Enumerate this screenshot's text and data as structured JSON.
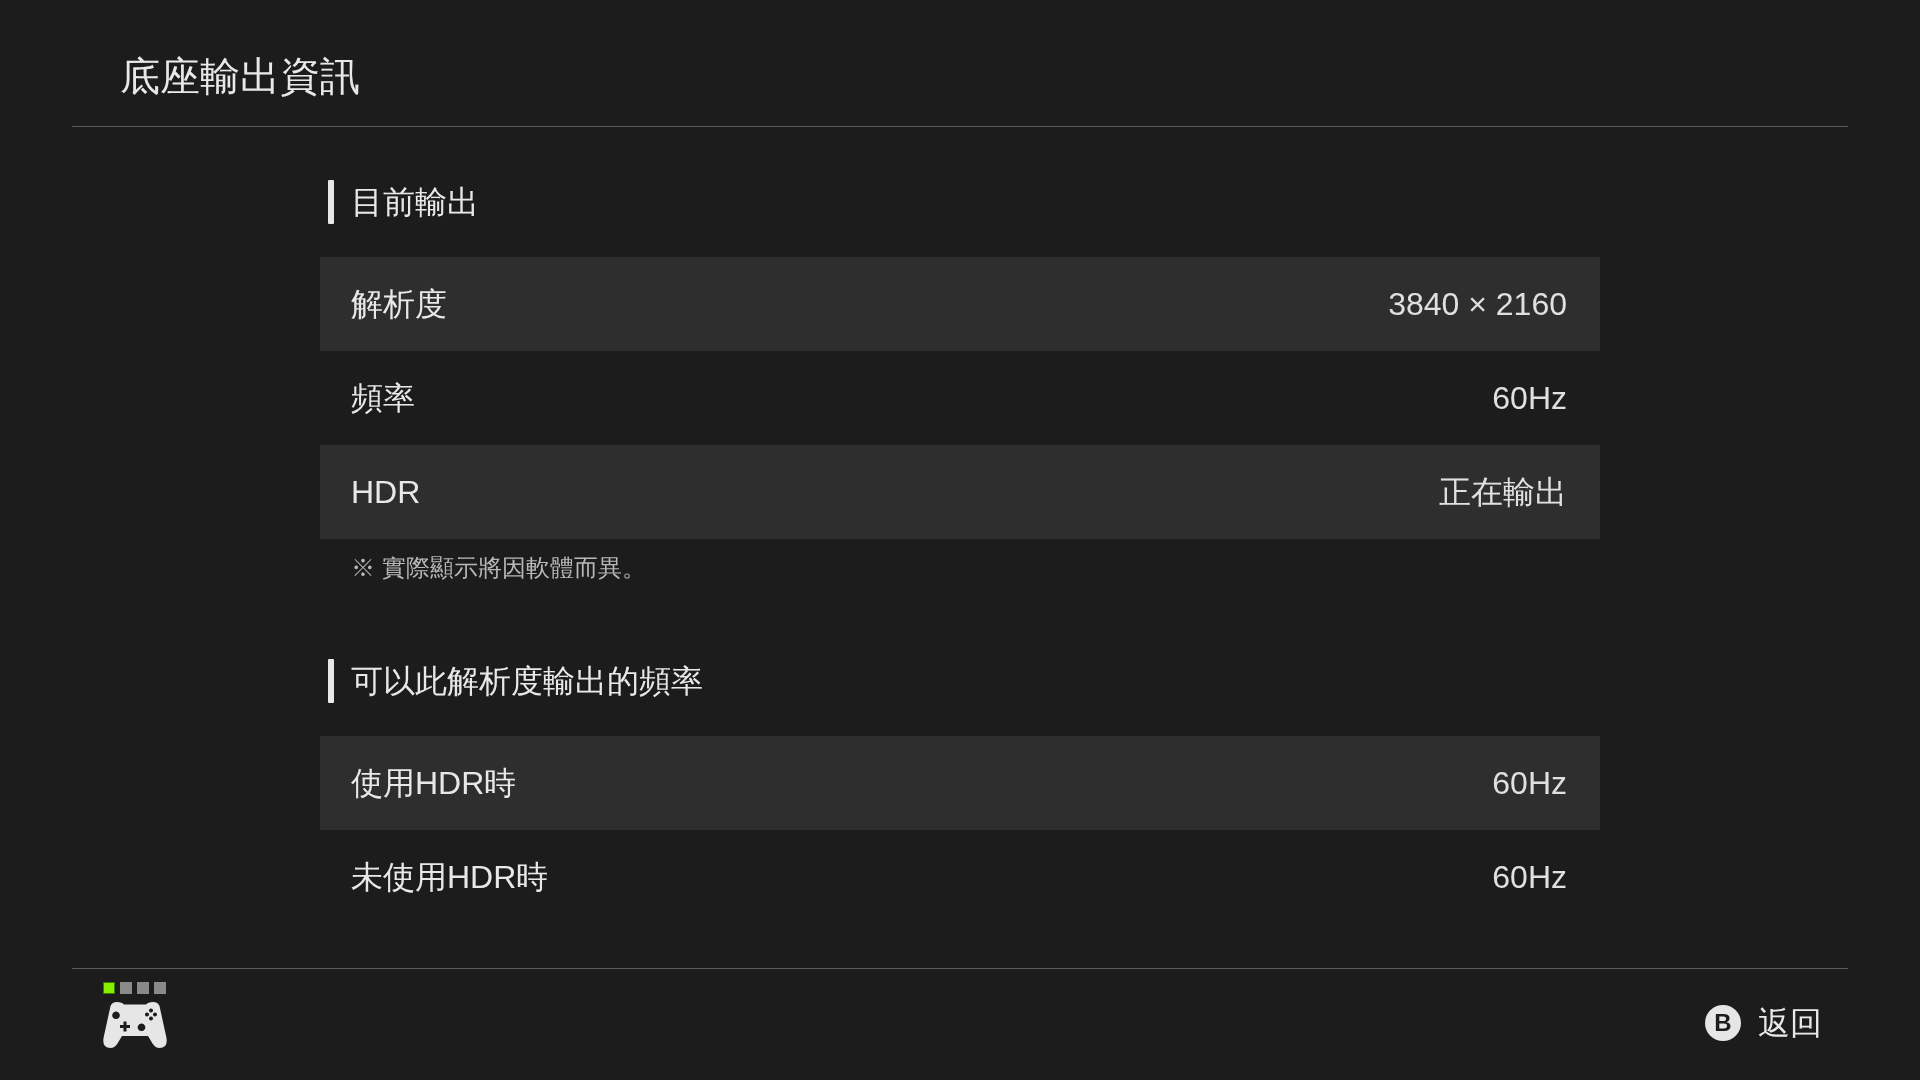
{
  "title": "底座輸出資訊",
  "sections": [
    {
      "heading": "目前輸出",
      "rows": [
        {
          "label": "解析度",
          "value": "3840 × 2160"
        },
        {
          "label": "頻率",
          "value": "60Hz"
        },
        {
          "label": "HDR",
          "value": "正在輸出"
        }
      ],
      "note": "※ 實際顯示將因軟體而異。"
    },
    {
      "heading": "可以此解析度輸出的頻率",
      "rows": [
        {
          "label": "使用HDR時",
          "value": "60Hz"
        },
        {
          "label": "未使用HDR時",
          "value": "60Hz"
        }
      ]
    }
  ],
  "footer": {
    "player_lamps": [
      {
        "on": true
      },
      {
        "on": false
      },
      {
        "on": false
      },
      {
        "on": false
      }
    ],
    "back_button": {
      "key": "B",
      "label": "返回"
    }
  }
}
